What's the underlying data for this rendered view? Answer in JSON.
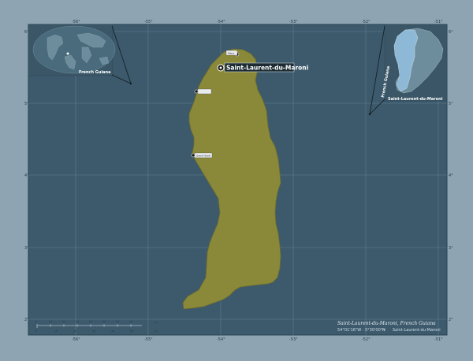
{
  "map": {
    "region_name": "Saint-Laurent-du-Maroni",
    "colors": {
      "page_background": "#8fa4b3",
      "map_background": "#3d5a6c",
      "region_fill": "#8a8839",
      "region_stroke": "#6d6c2c",
      "grid": "#5f7f90",
      "inset_background": "#3b5767",
      "inset_highlight": "#8db9d6"
    },
    "lat_ticks": [
      "6°",
      "5°",
      "4°",
      "3°",
      "2°"
    ],
    "lon_ticks": [
      "-56°",
      "-55°",
      "-54°",
      "-53°",
      "-52°",
      "-51°"
    ],
    "world_inset": {
      "label": "French Guiana",
      "pointer_label": ""
    },
    "country_inset": {
      "country_label": "French Guiana",
      "region_label": "Saint-Laurent-du-Maroni"
    },
    "capital": {
      "name": "Saint-Laurent-du-Maroni",
      "icon": "capital-marker-icon"
    },
    "towns": [
      "Mana",
      "",
      "Grand-Santi",
      "Papaïchton"
    ],
    "scale_bar": {
      "top_ticks": [
        "0",
        "10",
        "20",
        "30",
        "40",
        "50",
        "60",
        "70",
        "80",
        "90"
      ],
      "bottom_ticks": [
        "0",
        "10",
        "20",
        "30",
        "40",
        "50",
        "60"
      ],
      "units": [
        "km",
        "mi"
      ]
    },
    "footer": {
      "title": "Saint-Laurent-du-Maroni, French Guiana",
      "coords": "54°01'16\"W  ·  5°30'00\"N",
      "arrow": "→",
      "place": "Saint-Laurent-du-Maroni"
    }
  }
}
